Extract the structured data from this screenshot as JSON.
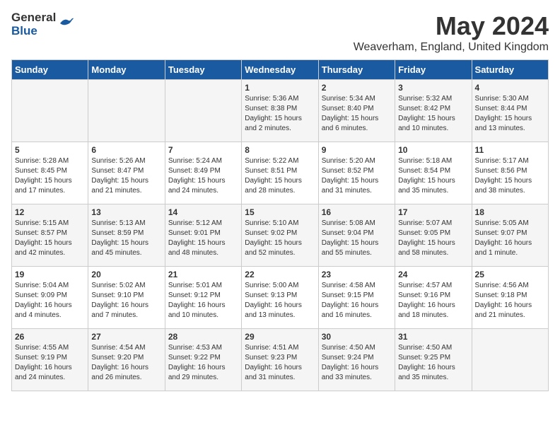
{
  "header": {
    "logo_general": "General",
    "logo_blue": "Blue",
    "month": "May 2024",
    "location": "Weaverham, England, United Kingdom"
  },
  "weekdays": [
    "Sunday",
    "Monday",
    "Tuesday",
    "Wednesday",
    "Thursday",
    "Friday",
    "Saturday"
  ],
  "weeks": [
    [
      {
        "day": "",
        "info": ""
      },
      {
        "day": "",
        "info": ""
      },
      {
        "day": "",
        "info": ""
      },
      {
        "day": "1",
        "info": "Sunrise: 5:36 AM\nSunset: 8:38 PM\nDaylight: 15 hours\nand 2 minutes."
      },
      {
        "day": "2",
        "info": "Sunrise: 5:34 AM\nSunset: 8:40 PM\nDaylight: 15 hours\nand 6 minutes."
      },
      {
        "day": "3",
        "info": "Sunrise: 5:32 AM\nSunset: 8:42 PM\nDaylight: 15 hours\nand 10 minutes."
      },
      {
        "day": "4",
        "info": "Sunrise: 5:30 AM\nSunset: 8:44 PM\nDaylight: 15 hours\nand 13 minutes."
      }
    ],
    [
      {
        "day": "5",
        "info": "Sunrise: 5:28 AM\nSunset: 8:45 PM\nDaylight: 15 hours\nand 17 minutes."
      },
      {
        "day": "6",
        "info": "Sunrise: 5:26 AM\nSunset: 8:47 PM\nDaylight: 15 hours\nand 21 minutes."
      },
      {
        "day": "7",
        "info": "Sunrise: 5:24 AM\nSunset: 8:49 PM\nDaylight: 15 hours\nand 24 minutes."
      },
      {
        "day": "8",
        "info": "Sunrise: 5:22 AM\nSunset: 8:51 PM\nDaylight: 15 hours\nand 28 minutes."
      },
      {
        "day": "9",
        "info": "Sunrise: 5:20 AM\nSunset: 8:52 PM\nDaylight: 15 hours\nand 31 minutes."
      },
      {
        "day": "10",
        "info": "Sunrise: 5:18 AM\nSunset: 8:54 PM\nDaylight: 15 hours\nand 35 minutes."
      },
      {
        "day": "11",
        "info": "Sunrise: 5:17 AM\nSunset: 8:56 PM\nDaylight: 15 hours\nand 38 minutes."
      }
    ],
    [
      {
        "day": "12",
        "info": "Sunrise: 5:15 AM\nSunset: 8:57 PM\nDaylight: 15 hours\nand 42 minutes."
      },
      {
        "day": "13",
        "info": "Sunrise: 5:13 AM\nSunset: 8:59 PM\nDaylight: 15 hours\nand 45 minutes."
      },
      {
        "day": "14",
        "info": "Sunrise: 5:12 AM\nSunset: 9:01 PM\nDaylight: 15 hours\nand 48 minutes."
      },
      {
        "day": "15",
        "info": "Sunrise: 5:10 AM\nSunset: 9:02 PM\nDaylight: 15 hours\nand 52 minutes."
      },
      {
        "day": "16",
        "info": "Sunrise: 5:08 AM\nSunset: 9:04 PM\nDaylight: 15 hours\nand 55 minutes."
      },
      {
        "day": "17",
        "info": "Sunrise: 5:07 AM\nSunset: 9:05 PM\nDaylight: 15 hours\nand 58 minutes."
      },
      {
        "day": "18",
        "info": "Sunrise: 5:05 AM\nSunset: 9:07 PM\nDaylight: 16 hours\nand 1 minute."
      }
    ],
    [
      {
        "day": "19",
        "info": "Sunrise: 5:04 AM\nSunset: 9:09 PM\nDaylight: 16 hours\nand 4 minutes."
      },
      {
        "day": "20",
        "info": "Sunrise: 5:02 AM\nSunset: 9:10 PM\nDaylight: 16 hours\nand 7 minutes."
      },
      {
        "day": "21",
        "info": "Sunrise: 5:01 AM\nSunset: 9:12 PM\nDaylight: 16 hours\nand 10 minutes."
      },
      {
        "day": "22",
        "info": "Sunrise: 5:00 AM\nSunset: 9:13 PM\nDaylight: 16 hours\nand 13 minutes."
      },
      {
        "day": "23",
        "info": "Sunrise: 4:58 AM\nSunset: 9:15 PM\nDaylight: 16 hours\nand 16 minutes."
      },
      {
        "day": "24",
        "info": "Sunrise: 4:57 AM\nSunset: 9:16 PM\nDaylight: 16 hours\nand 18 minutes."
      },
      {
        "day": "25",
        "info": "Sunrise: 4:56 AM\nSunset: 9:18 PM\nDaylight: 16 hours\nand 21 minutes."
      }
    ],
    [
      {
        "day": "26",
        "info": "Sunrise: 4:55 AM\nSunset: 9:19 PM\nDaylight: 16 hours\nand 24 minutes."
      },
      {
        "day": "27",
        "info": "Sunrise: 4:54 AM\nSunset: 9:20 PM\nDaylight: 16 hours\nand 26 minutes."
      },
      {
        "day": "28",
        "info": "Sunrise: 4:53 AM\nSunset: 9:22 PM\nDaylight: 16 hours\nand 29 minutes."
      },
      {
        "day": "29",
        "info": "Sunrise: 4:51 AM\nSunset: 9:23 PM\nDaylight: 16 hours\nand 31 minutes."
      },
      {
        "day": "30",
        "info": "Sunrise: 4:50 AM\nSunset: 9:24 PM\nDaylight: 16 hours\nand 33 minutes."
      },
      {
        "day": "31",
        "info": "Sunrise: 4:50 AM\nSunset: 9:25 PM\nDaylight: 16 hours\nand 35 minutes."
      },
      {
        "day": "",
        "info": ""
      }
    ]
  ]
}
